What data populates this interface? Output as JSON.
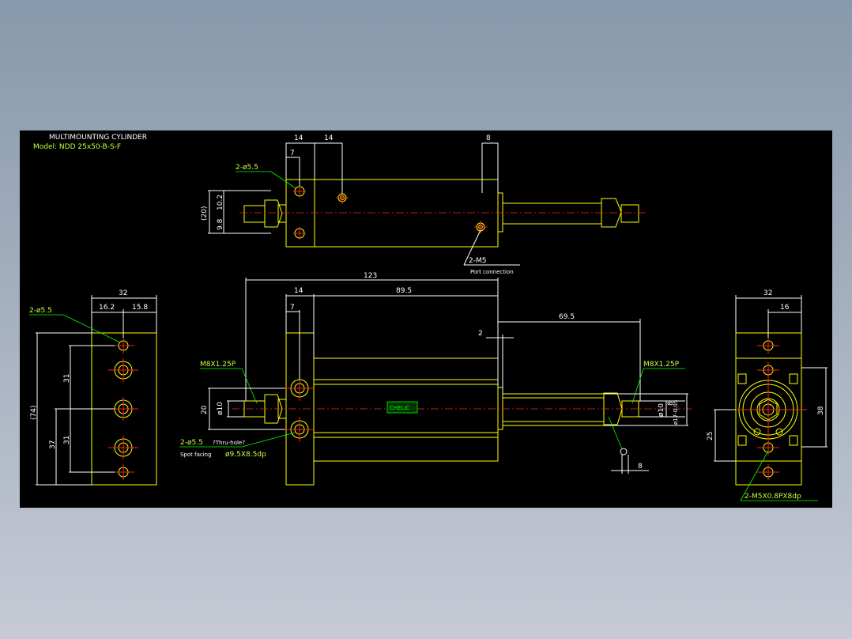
{
  "title": "MULTIMOUNTING CYLINDER",
  "model": "Model: NDD 25x50-B-S-F",
  "top_view": {
    "dim_14a": "14",
    "dim_14b": "14",
    "dim_7": "7",
    "dim_8": "8",
    "hole_label": "2-ø5.5",
    "dim_20": "(20)",
    "dim_10_2": "10.2",
    "dim_9_8": "9.8",
    "port_label": "2-M5",
    "port_sub": "Port connection"
  },
  "side_view": {
    "dim_32": "32",
    "dim_16_2": "16.2",
    "dim_15_8": "15.8",
    "hole_label": "2-ø5.5",
    "dim_74": "(74)",
    "dim_31a": "31",
    "dim_37": "37",
    "dim_31b": "31"
  },
  "front_view": {
    "dim_123": "123",
    "dim_14": "14",
    "dim_89_5": "89.5",
    "dim_7": "7",
    "dim_69_5": "69.5",
    "dim_2": "2",
    "thread_left": "M8X1.25P",
    "thread_right": "M8X1.25P",
    "dim_20": "20",
    "dim_phi10": "ø10",
    "dim_phi10r": "ø10",
    "dim_8v": "8",
    "dim_phi17": "ø17-0.05",
    "hole_note": "2-ø5.5",
    "hole_note_sub": "?Thru-hole?",
    "spot_note_a": "Spot facing",
    "spot_note_b": "ø9.5X8.5dp",
    "dim_8b": "8",
    "brand": "CHELIC"
  },
  "end_view": {
    "dim_32": "32",
    "dim_16": "16",
    "dim_38": "38",
    "dim_25": "25",
    "tap_label": "2-M5X0.8PX8dp"
  }
}
